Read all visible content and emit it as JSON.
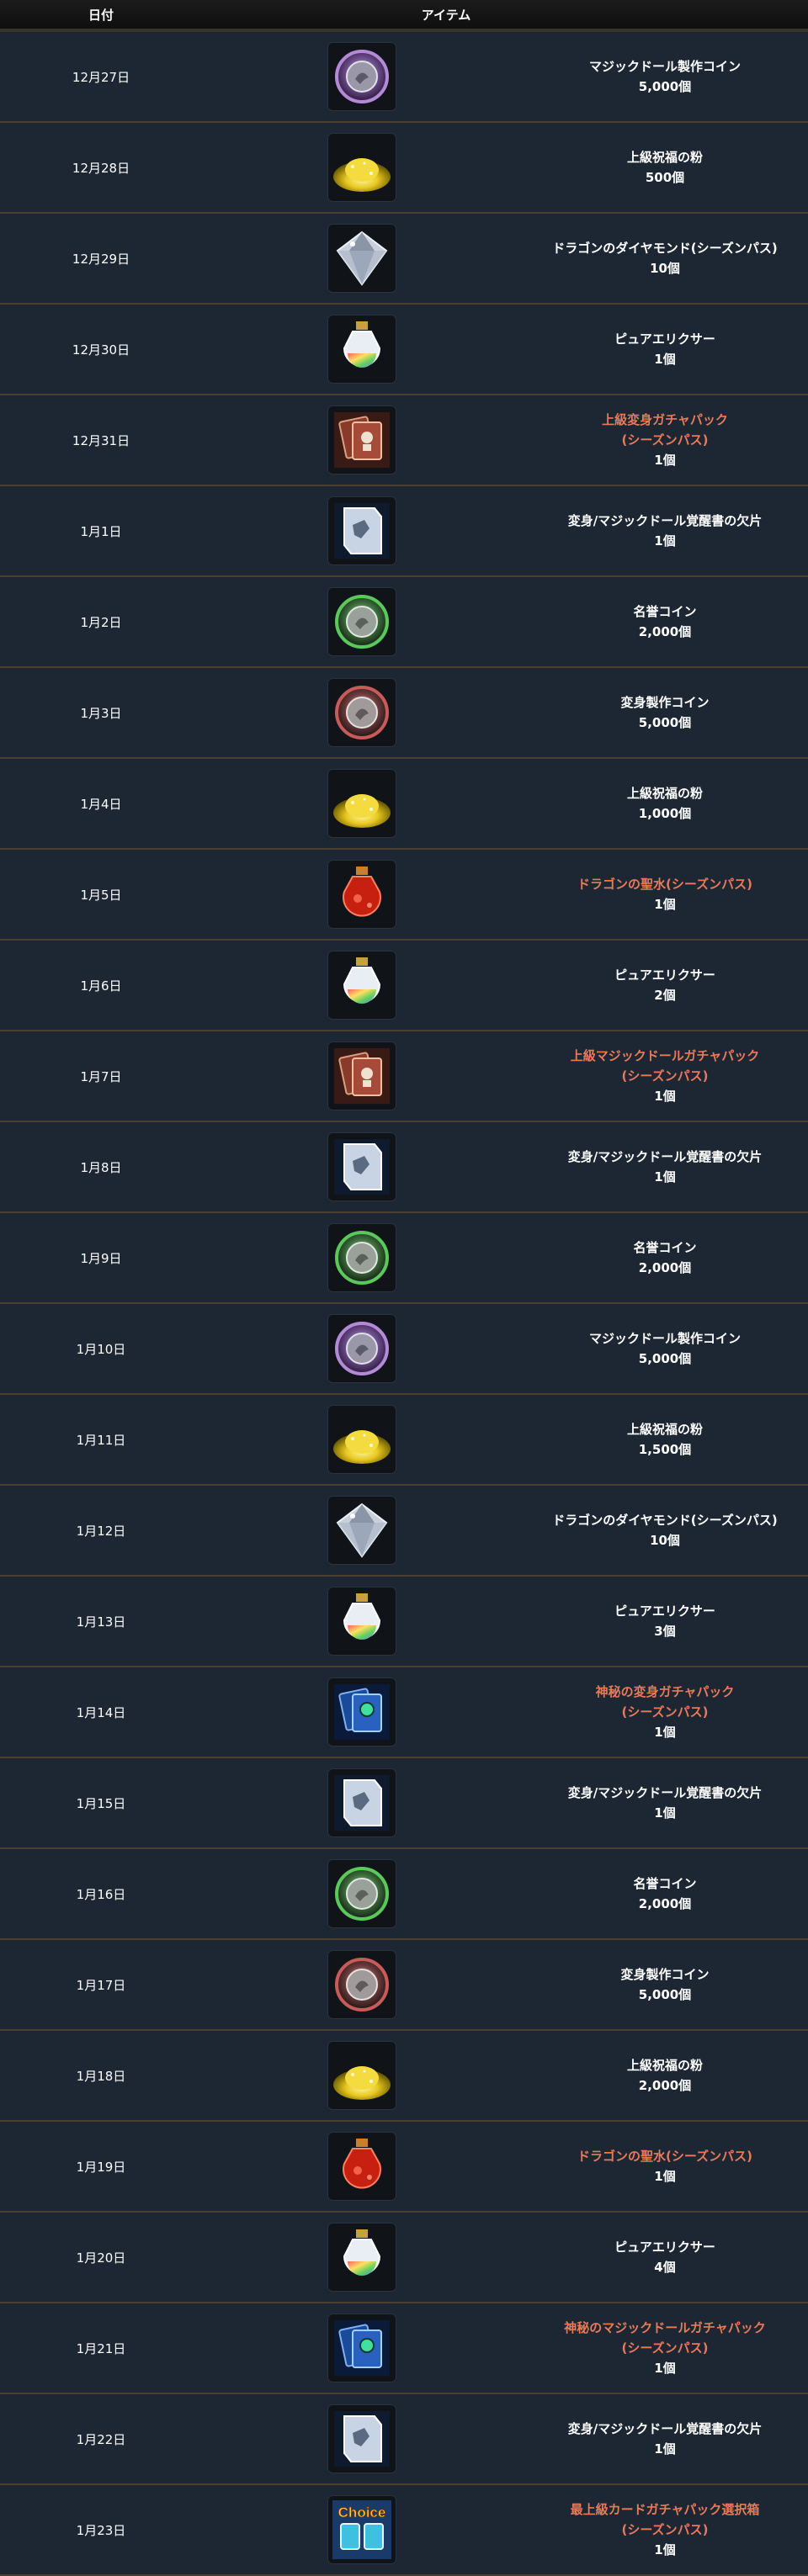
{
  "header": {
    "date_label": "日付",
    "item_label": "アイテム"
  },
  "rows": [
    {
      "date": "12月27日",
      "icon": "coin-purple-icon",
      "lines": [
        "マジックドール製作コイン",
        "5,000個"
      ],
      "special": false
    },
    {
      "date": "12月28日",
      "icon": "gold-powder-icon",
      "lines": [
        "上級祝福の粉",
        "500個"
      ],
      "special": false
    },
    {
      "date": "12月29日",
      "icon": "diamond-icon",
      "lines": [
        "ドラゴンのダイヤモンド(シーズンパス)",
        "10個"
      ],
      "special": false
    },
    {
      "date": "12月30日",
      "icon": "elixir-icon",
      "lines": [
        "ピュアエリクサー",
        "1個"
      ],
      "special": false
    },
    {
      "date": "12月31日",
      "icon": "card-pack-red-icon",
      "lines": [
        "上級変身ガチャパック",
        "(シーズンパス)",
        "1個"
      ],
      "special": true,
      "special_lines": 2
    },
    {
      "date": "1月1日",
      "icon": "scroll-icon",
      "lines": [
        "変身/マジックドール覚醒書の欠片",
        "1個"
      ],
      "special": false
    },
    {
      "date": "1月2日",
      "icon": "coin-green-icon",
      "lines": [
        "名誉コイン",
        "2,000個"
      ],
      "special": false
    },
    {
      "date": "1月3日",
      "icon": "coin-red-icon",
      "lines": [
        "変身製作コイン",
        "5,000個"
      ],
      "special": false
    },
    {
      "date": "1月4日",
      "icon": "gold-powder-icon",
      "lines": [
        "上級祝福の粉",
        "1,000個"
      ],
      "special": false
    },
    {
      "date": "1月5日",
      "icon": "red-potion-icon",
      "lines": [
        "ドラゴンの聖水(シーズンパス)",
        "1個"
      ],
      "special": true,
      "special_lines": 1
    },
    {
      "date": "1月6日",
      "icon": "elixir-icon",
      "lines": [
        "ピュアエリクサー",
        "2個"
      ],
      "special": false
    },
    {
      "date": "1月7日",
      "icon": "card-pack-red-icon",
      "lines": [
        "上級マジックドールガチャパック",
        "(シーズンパス)",
        "1個"
      ],
      "special": true,
      "special_lines": 2
    },
    {
      "date": "1月8日",
      "icon": "scroll-icon",
      "lines": [
        "変身/マジックドール覚醒書の欠片",
        "1個"
      ],
      "special": false
    },
    {
      "date": "1月9日",
      "icon": "coin-green-icon",
      "lines": [
        "名誉コイン",
        "2,000個"
      ],
      "special": false
    },
    {
      "date": "1月10日",
      "icon": "coin-purple-icon",
      "lines": [
        "マジックドール製作コイン",
        "5,000個"
      ],
      "special": false
    },
    {
      "date": "1月11日",
      "icon": "gold-powder-icon",
      "lines": [
        "上級祝福の粉",
        "1,500個"
      ],
      "special": false
    },
    {
      "date": "1月12日",
      "icon": "diamond-icon",
      "lines": [
        "ドラゴンのダイヤモンド(シーズンパス)",
        "10個"
      ],
      "special": false
    },
    {
      "date": "1月13日",
      "icon": "elixir-icon",
      "lines": [
        "ピュアエリクサー",
        "3個"
      ],
      "special": false
    },
    {
      "date": "1月14日",
      "icon": "card-pack-blue-icon",
      "lines": [
        "神秘の変身ガチャパック",
        "(シーズンパス)",
        "1個"
      ],
      "special": true,
      "special_lines": 2
    },
    {
      "date": "1月15日",
      "icon": "scroll-icon",
      "lines": [
        "変身/マジックドール覚醒書の欠片",
        "1個"
      ],
      "special": false
    },
    {
      "date": "1月16日",
      "icon": "coin-green-icon",
      "lines": [
        "名誉コイン",
        "2,000個"
      ],
      "special": false
    },
    {
      "date": "1月17日",
      "icon": "coin-red-icon",
      "lines": [
        "変身製作コイン",
        "5,000個"
      ],
      "special": false
    },
    {
      "date": "1月18日",
      "icon": "gold-powder-icon",
      "lines": [
        "上級祝福の粉",
        "2,000個"
      ],
      "special": false
    },
    {
      "date": "1月19日",
      "icon": "red-potion-icon",
      "lines": [
        "ドラゴンの聖水(シーズンパス)",
        "1個"
      ],
      "special": true,
      "special_lines": 1
    },
    {
      "date": "1月20日",
      "icon": "elixir-icon",
      "lines": [
        "ピュアエリクサー",
        "4個"
      ],
      "special": false
    },
    {
      "date": "1月21日",
      "icon": "card-pack-blue-icon",
      "lines": [
        "神秘のマジックドールガチャパック",
        "(シーズンパス)",
        "1個"
      ],
      "special": true,
      "special_lines": 2
    },
    {
      "date": "1月22日",
      "icon": "scroll-icon",
      "lines": [
        "変身/マジックドール覚醒書の欠片",
        "1個"
      ],
      "special": false
    },
    {
      "date": "1月23日",
      "icon": "choice-card-pack-icon",
      "icon_text": "Choice",
      "lines": [
        "最上級カードガチャパック選択箱",
        "(シーズンパス)",
        "1個"
      ],
      "special": true,
      "special_lines": 2
    }
  ],
  "colors": {
    "background": "#1d2733",
    "header_bg": "#141414",
    "row_divider": "#4a4032",
    "special_text": "#e87a5a",
    "normal_text": "#ffffff"
  }
}
